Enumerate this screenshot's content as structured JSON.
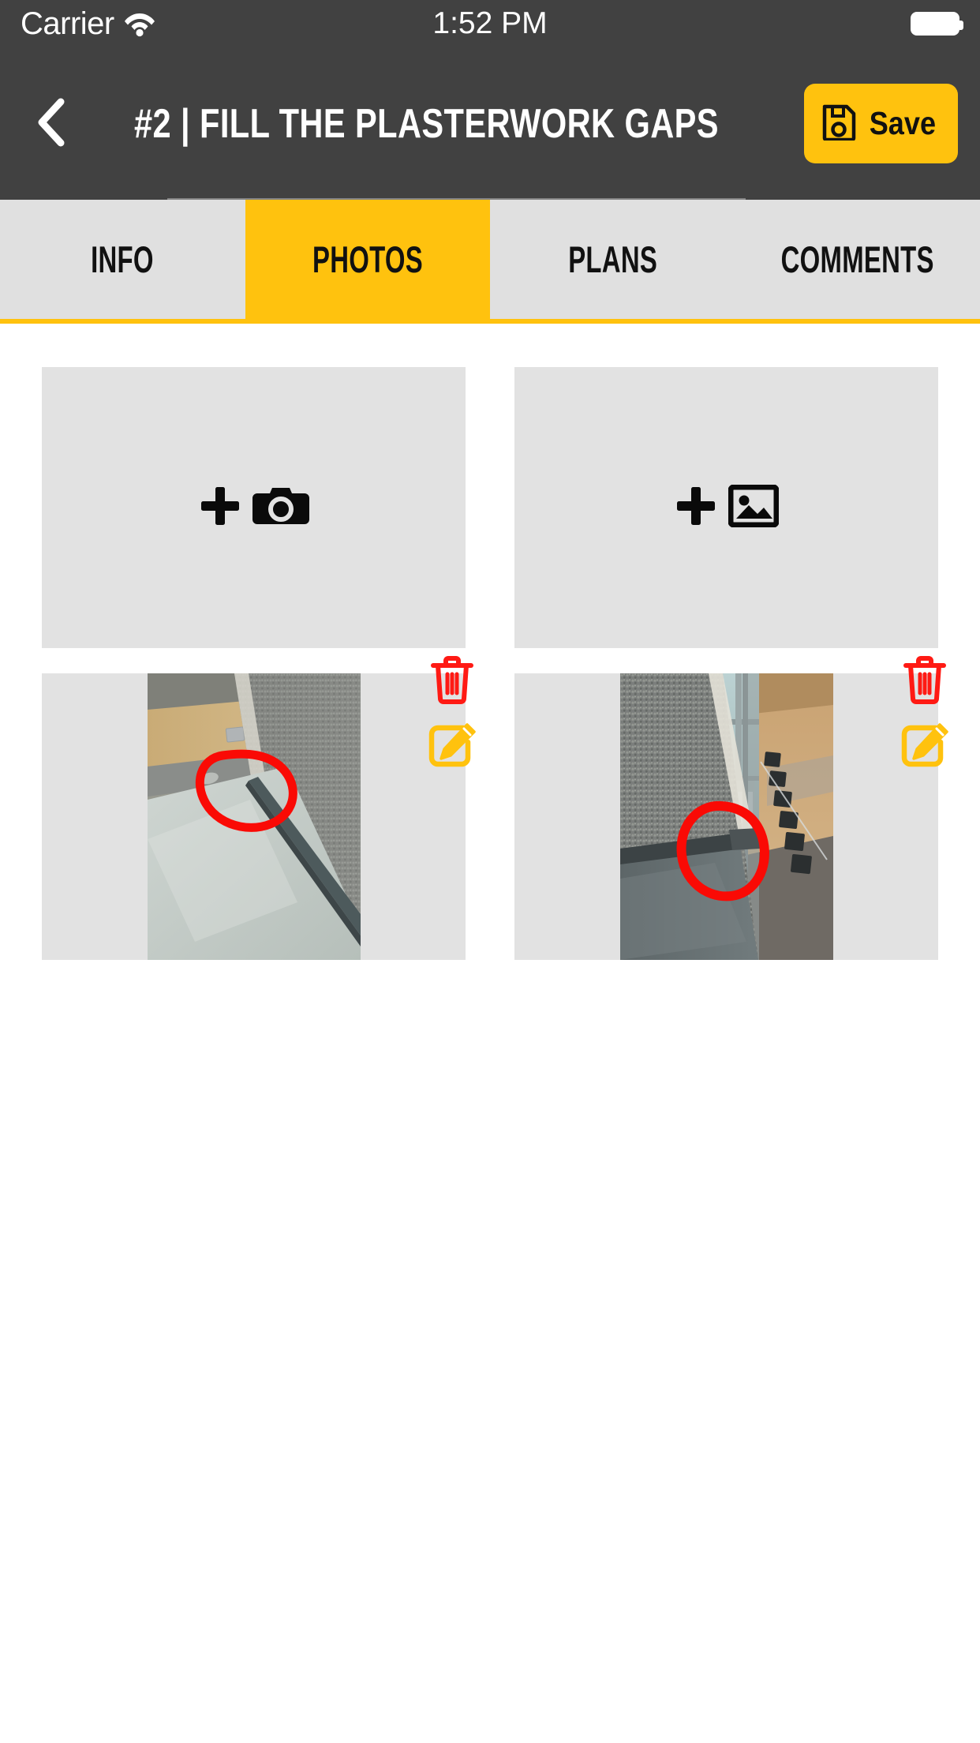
{
  "status_bar": {
    "carrier": "Carrier",
    "wifi_icon": "wifi-icon",
    "time": "1:52 PM",
    "battery_icon": "battery-full-icon"
  },
  "header": {
    "back_icon": "chevron-left-icon",
    "title": "#2 | FILL THE PLASTERWORK GAPS",
    "save_label": "Save",
    "save_icon": "floppy-disk-save-icon"
  },
  "tabs": [
    {
      "label": "INFO",
      "active": false
    },
    {
      "label": "PHOTOS",
      "active": true
    },
    {
      "label": "PLANS",
      "active": false
    },
    {
      "label": "COMMENTS",
      "active": false
    }
  ],
  "photos_tab": {
    "add_camera_tile": {
      "plus_icon": "plus-icon",
      "icon": "camera-icon"
    },
    "add_gallery_tile": {
      "plus_icon": "plus-icon",
      "icon": "image-gallery-icon"
    },
    "thumbnails": [
      {
        "name": "photo-thumbnail-1",
        "description": "Close-up of roof edge metal flashing meeting grey rendered plaster wall with red circle annotation marking the gap",
        "delete_icon": "trash-icon",
        "edit_icon": "pencil-edit-icon"
      },
      {
        "name": "photo-thumbnail-2",
        "description": "Overhead view of building facade corner with grey plaster, glass balustrade and red circle annotation marking the gap",
        "delete_icon": "trash-icon",
        "edit_icon": "pencil-edit-icon"
      }
    ]
  },
  "colors": {
    "accent_yellow": "#FFC20E",
    "header_dark": "#414141",
    "tab_inactive": "#e0e0e0",
    "placeholder_gray": "#e2e2e2",
    "delete_red": "#FF1A14",
    "edit_yellow": "#FFC20E",
    "annotation_red": "#FA0A05"
  }
}
